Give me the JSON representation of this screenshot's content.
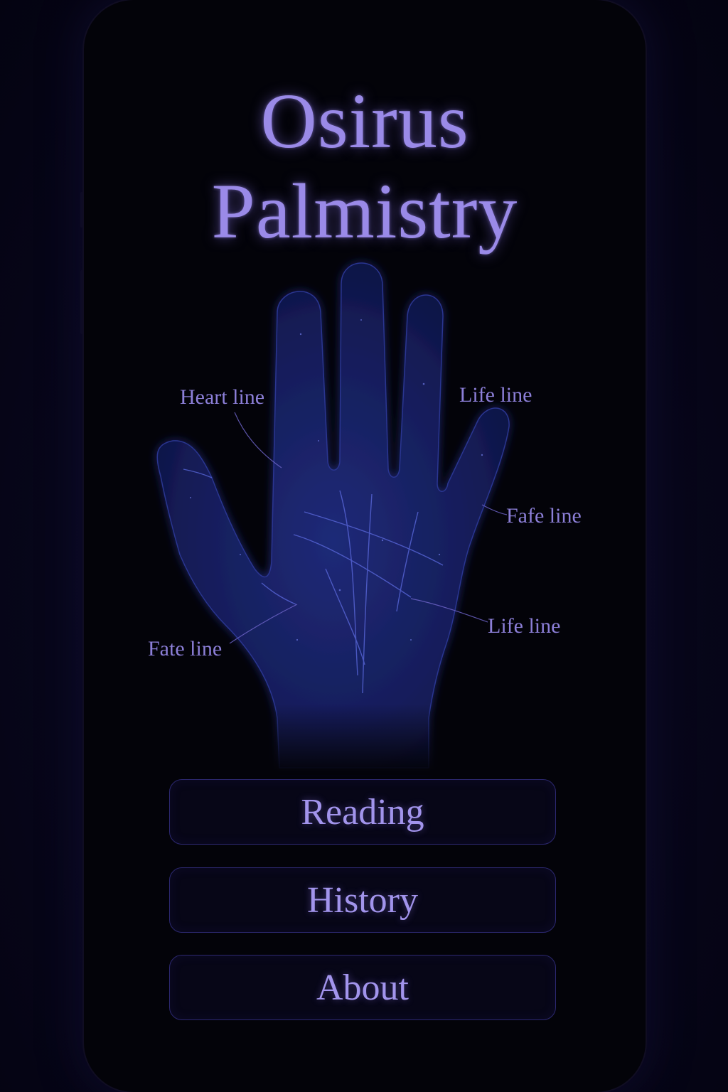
{
  "app": {
    "title_line1": "Osirus",
    "title_line2": "Palmistry"
  },
  "hand": {
    "icon": "palm-hand-icon",
    "labels": {
      "top_left": "Heart line",
      "top_right": "Life line",
      "middle_right": "Fafe line",
      "lower_right": "Life line",
      "lower_left": "Fate line"
    }
  },
  "menu": {
    "items": [
      {
        "label": "Reading"
      },
      {
        "label": "History"
      },
      {
        "label": "About"
      }
    ]
  },
  "colors": {
    "accent": "#9a8ae8",
    "background": "#030309",
    "hand": "#1a2366",
    "button_border": "#2c2870"
  }
}
